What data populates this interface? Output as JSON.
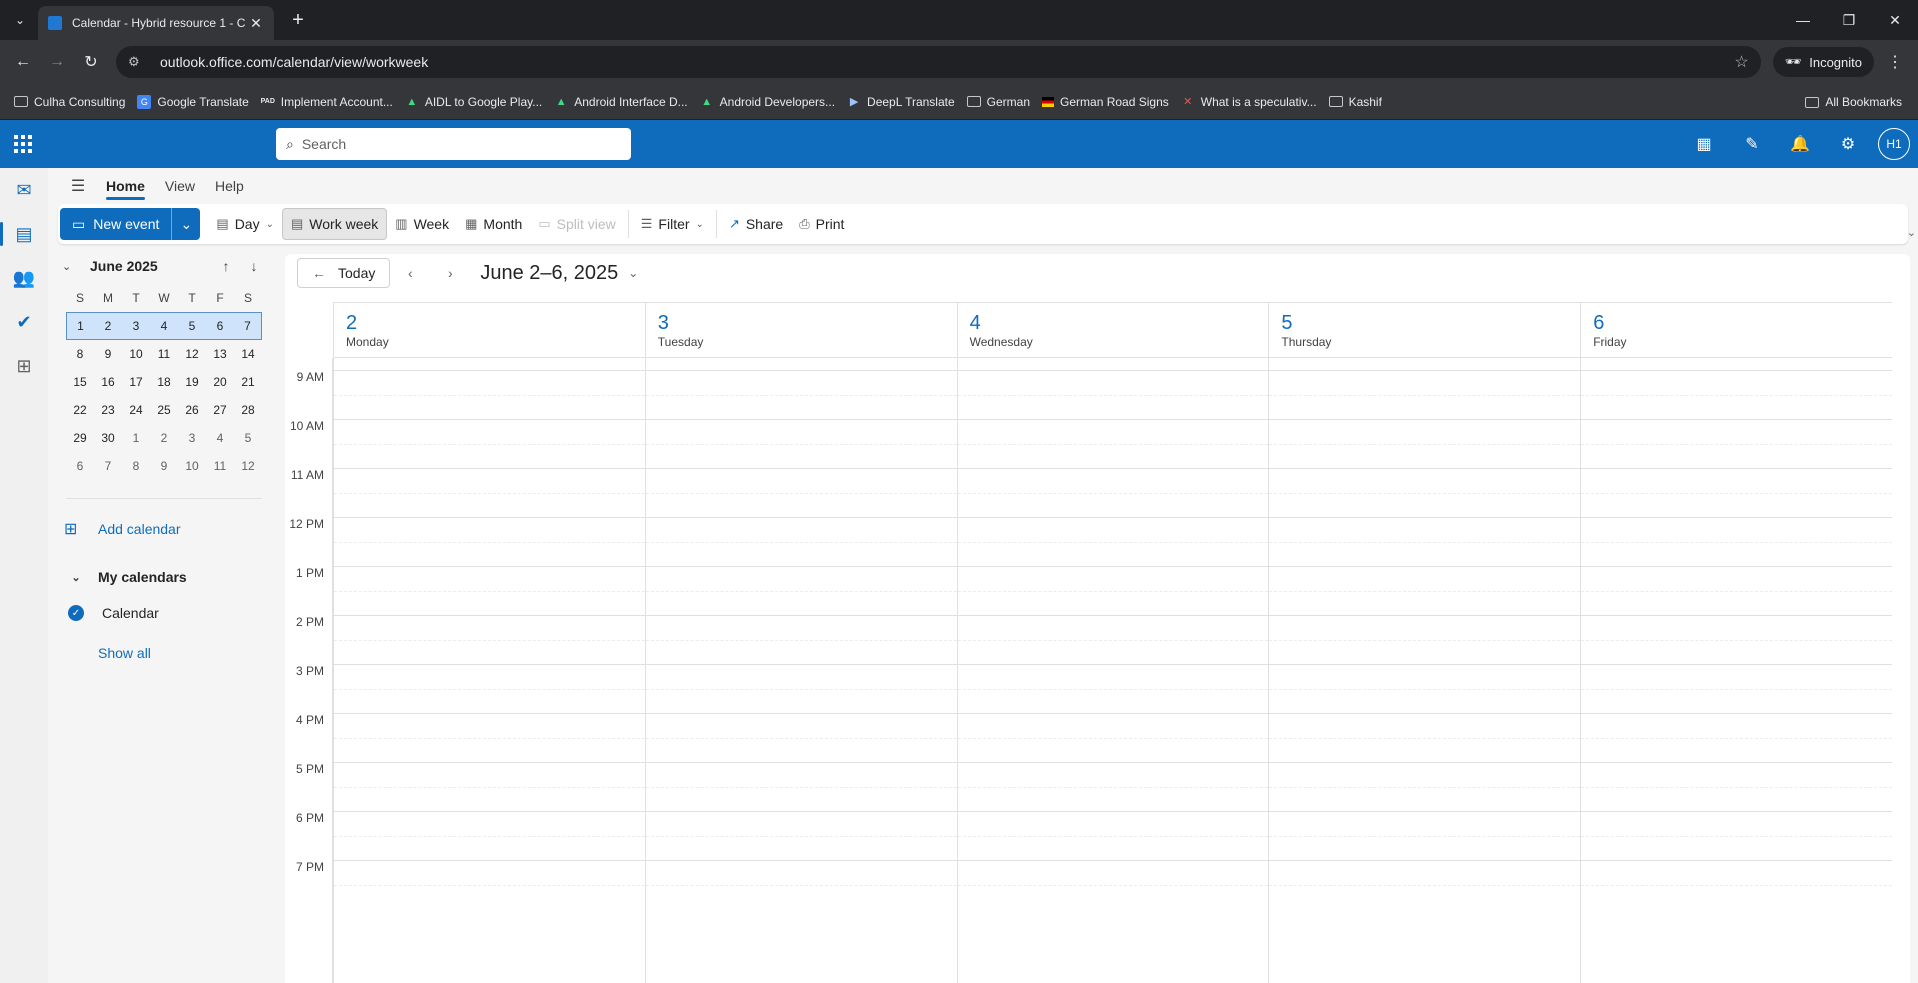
{
  "browser": {
    "tab_title": "Calendar - Hybrid resource 1 - C",
    "url": "outlook.office.com/calendar/view/workweek",
    "incognito_label": "Incognito",
    "bookmarks": [
      {
        "label": "Culha Consulting",
        "icon": "folder-icon"
      },
      {
        "label": "Google Translate",
        "icon": "google-translate-icon"
      },
      {
        "label": "Implement Account...",
        "icon": "pad-icon"
      },
      {
        "label": "AIDL to Google Play...",
        "icon": "android-icon"
      },
      {
        "label": "Android Interface D...",
        "icon": "android-icon"
      },
      {
        "label": "Android Developers...",
        "icon": "android-icon"
      },
      {
        "label": "DeepL Translate",
        "icon": "deepl-icon"
      },
      {
        "label": "German",
        "icon": "folder-icon"
      },
      {
        "label": "German Road Signs",
        "icon": "german-flag-icon"
      },
      {
        "label": "What is a speculativ...",
        "icon": "x-icon"
      },
      {
        "label": "Kashif",
        "icon": "folder-icon"
      }
    ],
    "all_bookmarks": "All Bookmarks"
  },
  "header": {
    "search_placeholder": "Search",
    "avatar_initials": "H1",
    "accent": "#0f6cbd"
  },
  "ribbon": {
    "tabs": [
      "Home",
      "View",
      "Help"
    ],
    "new_event": "New event",
    "day": "Day",
    "work_week": "Work week",
    "week": "Week",
    "month": "Month",
    "split_view": "Split view",
    "filter": "Filter",
    "share": "Share",
    "print": "Print"
  },
  "mini_calendar": {
    "month_label": "June 2025",
    "weekdays": [
      "S",
      "M",
      "T",
      "W",
      "T",
      "F",
      "S"
    ],
    "weeks": [
      [
        "1",
        "2",
        "3",
        "4",
        "5",
        "6",
        "7"
      ],
      [
        "8",
        "9",
        "10",
        "11",
        "12",
        "13",
        "14"
      ],
      [
        "15",
        "16",
        "17",
        "18",
        "19",
        "20",
        "21"
      ],
      [
        "22",
        "23",
        "24",
        "25",
        "26",
        "27",
        "28"
      ],
      [
        "29",
        "30",
        "1",
        "2",
        "3",
        "4",
        "5"
      ],
      [
        "6",
        "7",
        "8",
        "9",
        "10",
        "11",
        "12"
      ]
    ],
    "selected_week_index": 0
  },
  "pane": {
    "add_calendar": "Add calendar",
    "my_calendars": "My calendars",
    "calendar_item": "Calendar",
    "show_all": "Show all"
  },
  "calendar": {
    "today": "Today",
    "range": "June 2–6, 2025",
    "days": [
      {
        "num": "2",
        "name": "Monday"
      },
      {
        "num": "3",
        "name": "Tuesday"
      },
      {
        "num": "4",
        "name": "Wednesday"
      },
      {
        "num": "5",
        "name": "Thursday"
      },
      {
        "num": "6",
        "name": "Friday"
      }
    ],
    "time_labels": [
      "9 AM",
      "10 AM",
      "11 AM",
      "12 PM",
      "1 PM",
      "2 PM",
      "3 PM",
      "4 PM",
      "5 PM",
      "6 PM",
      "7 PM"
    ]
  }
}
